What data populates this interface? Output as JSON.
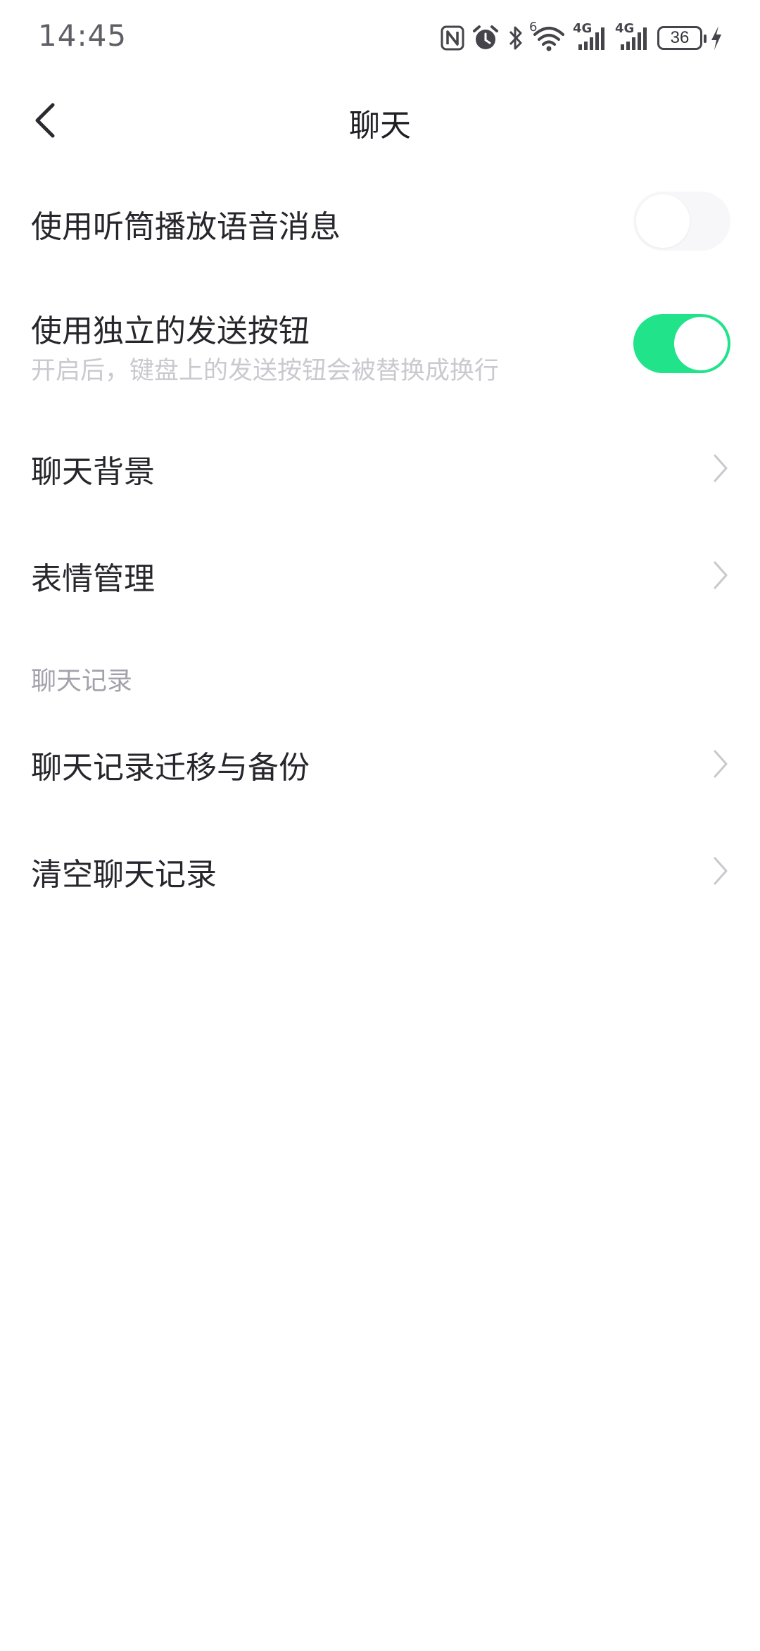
{
  "status_bar": {
    "time": "14:45",
    "battery": "36",
    "network_1": "4G",
    "network_2": "4G",
    "wifi_badge": "6",
    "icons": [
      "nfc-icon",
      "alarm-icon",
      "bluetooth-icon",
      "wifi-icon",
      "signal-icon",
      "signal-icon",
      "battery-icon",
      "charging-icon"
    ]
  },
  "header": {
    "title": "聊天"
  },
  "settings": {
    "earpiece": {
      "label": "使用听筒播放语音消息",
      "enabled": false
    },
    "send_button": {
      "label": "使用独立的发送按钮",
      "description": "开启后，键盘上的发送按钮会被替换成换行",
      "enabled": true
    },
    "chat_background": {
      "label": "聊天背景"
    },
    "sticker_management": {
      "label": "表情管理"
    }
  },
  "history_section": {
    "title": "聊天记录",
    "migrate_backup": {
      "label": "聊天记录迁移与备份"
    },
    "clear_history": {
      "label": "清空聊天记录"
    }
  },
  "colors": {
    "toggle_on": "#20e38a",
    "toggle_off": "#f7f7f9",
    "section_header": "#a2a2ab",
    "description": "#c9c9cf"
  }
}
